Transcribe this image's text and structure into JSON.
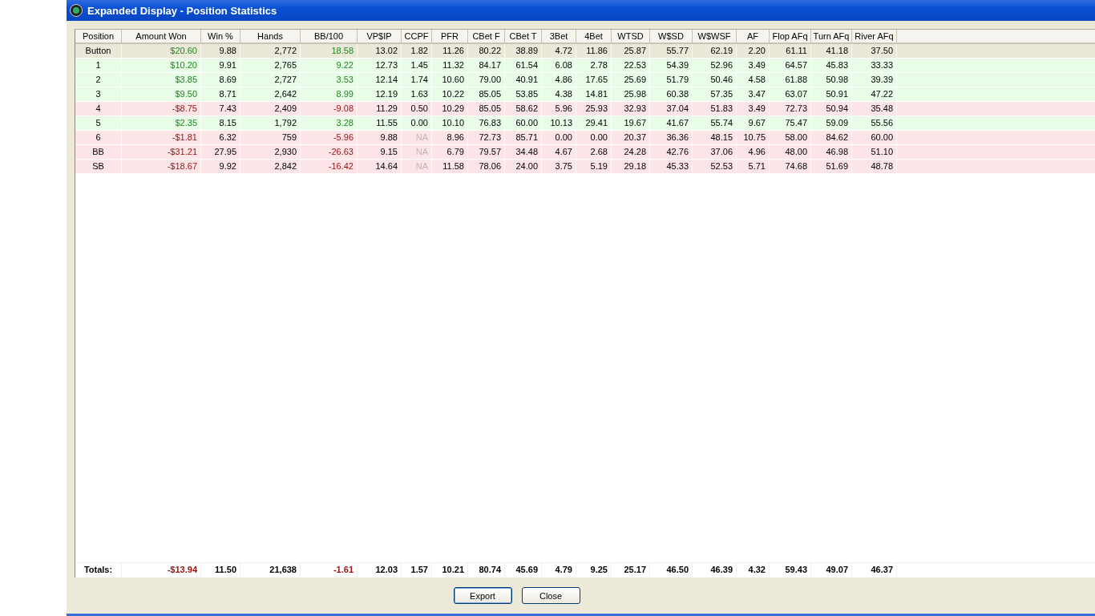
{
  "window": {
    "title": "Expanded Display - Position Statistics"
  },
  "table": {
    "columns": [
      {
        "label": "Position",
        "kind": "text"
      },
      {
        "label": "Amount Won",
        "kind": "signed"
      },
      {
        "label": "Win %",
        "kind": "number"
      },
      {
        "label": "Hands",
        "kind": "number"
      },
      {
        "label": "BB/100",
        "kind": "signed"
      },
      {
        "label": "VP$IP",
        "kind": "number"
      },
      {
        "label": "CCPF",
        "kind": "ccpf"
      },
      {
        "label": "PFR",
        "kind": "number"
      },
      {
        "label": "CBet F",
        "kind": "number"
      },
      {
        "label": "CBet T",
        "kind": "number"
      },
      {
        "label": "3Bet",
        "kind": "number"
      },
      {
        "label": "4Bet",
        "kind": "number"
      },
      {
        "label": "WTSD",
        "kind": "number"
      },
      {
        "label": "W$SD",
        "kind": "number"
      },
      {
        "label": "W$WSF",
        "kind": "number"
      },
      {
        "label": "AF",
        "kind": "number"
      },
      {
        "label": "Flop AFq",
        "kind": "number"
      },
      {
        "label": "Turn AFq",
        "kind": "number"
      },
      {
        "label": "River AFq",
        "kind": "number"
      }
    ],
    "rows": [
      {
        "selected": true,
        "kind": "win",
        "ccpf_disabled": false,
        "cells": [
          "Button",
          "$20.60",
          "9.88",
          "2,772",
          "18.58",
          "13.02",
          "1.82",
          "11.26",
          "80.22",
          "38.89",
          "4.72",
          "11.86",
          "25.87",
          "55.77",
          "62.19",
          "2.20",
          "61.11",
          "41.18",
          "37.50"
        ]
      },
      {
        "selected": false,
        "kind": "win",
        "ccpf_disabled": false,
        "cells": [
          "1",
          "$10.20",
          "9.91",
          "2,765",
          "9.22",
          "12.73",
          "1.45",
          "11.32",
          "84.17",
          "61.54",
          "6.08",
          "2.78",
          "22.53",
          "54.39",
          "52.96",
          "3.49",
          "64.57",
          "45.83",
          "33.33"
        ]
      },
      {
        "selected": false,
        "kind": "win",
        "ccpf_disabled": false,
        "cells": [
          "2",
          "$3.85",
          "8.69",
          "2,727",
          "3.53",
          "12.14",
          "1.74",
          "10.60",
          "79.00",
          "40.91",
          "4.86",
          "17.65",
          "25.69",
          "51.79",
          "50.46",
          "4.58",
          "61.88",
          "50.98",
          "39.39"
        ]
      },
      {
        "selected": false,
        "kind": "win",
        "ccpf_disabled": false,
        "cells": [
          "3",
          "$9.50",
          "8.71",
          "2,642",
          "8.99",
          "12.19",
          "1.63",
          "10.22",
          "85.05",
          "53.85",
          "4.38",
          "14.81",
          "25.98",
          "60.38",
          "57.35",
          "3.47",
          "63.07",
          "50.91",
          "47.22"
        ]
      },
      {
        "selected": false,
        "kind": "loss",
        "ccpf_disabled": false,
        "cells": [
          "4",
          "-$8.75",
          "7.43",
          "2,409",
          "-9.08",
          "11.29",
          "0.50",
          "10.29",
          "85.05",
          "58.62",
          "5.96",
          "25.93",
          "32.93",
          "37.04",
          "51.83",
          "3.49",
          "72.73",
          "50.94",
          "35.48"
        ]
      },
      {
        "selected": false,
        "kind": "win",
        "ccpf_disabled": false,
        "cells": [
          "5",
          "$2.35",
          "8.15",
          "1,792",
          "3.28",
          "11.55",
          "0.00",
          "10.10",
          "76.83",
          "60.00",
          "10.13",
          "29.41",
          "19.67",
          "41.67",
          "55.74",
          "9.67",
          "75.47",
          "59.09",
          "55.56"
        ]
      },
      {
        "selected": false,
        "kind": "loss",
        "ccpf_disabled": true,
        "cells": [
          "6",
          "-$1.81",
          "6.32",
          "759",
          "-5.96",
          "9.88",
          "NA",
          "8.96",
          "72.73",
          "85.71",
          "0.00",
          "0.00",
          "20.37",
          "36.36",
          "48.15",
          "10.75",
          "58.00",
          "84.62",
          "60.00"
        ]
      },
      {
        "selected": false,
        "kind": "loss",
        "ccpf_disabled": true,
        "cells": [
          "BB",
          "-$31.21",
          "27.95",
          "2,930",
          "-26.63",
          "9.15",
          "NA",
          "6.79",
          "79.57",
          "34.48",
          "4.67",
          "2.68",
          "24.28",
          "42.76",
          "37.06",
          "4.96",
          "48.00",
          "46.98",
          "51.10"
        ]
      },
      {
        "selected": false,
        "kind": "loss",
        "ccpf_disabled": true,
        "cells": [
          "SB",
          "-$18.67",
          "9.92",
          "2,842",
          "-16.42",
          "14.64",
          "NA",
          "11.58",
          "78.06",
          "24.00",
          "3.75",
          "5.19",
          "29.18",
          "45.33",
          "52.53",
          "5.71",
          "74.68",
          "51.69",
          "48.78"
        ]
      }
    ],
    "totals": {
      "kind": "loss",
      "cells": [
        "Totals:",
        "-$13.94",
        "11.50",
        "21,638",
        "-1.61",
        "12.03",
        "1.57",
        "10.21",
        "80.74",
        "45.69",
        "4.79",
        "9.25",
        "25.17",
        "46.50",
        "46.39",
        "4.32",
        "59.43",
        "49.07",
        "46.37"
      ]
    }
  },
  "buttons": [
    {
      "label": "Export",
      "selected": true
    },
    {
      "label": "Close",
      "selected": false
    }
  ]
}
